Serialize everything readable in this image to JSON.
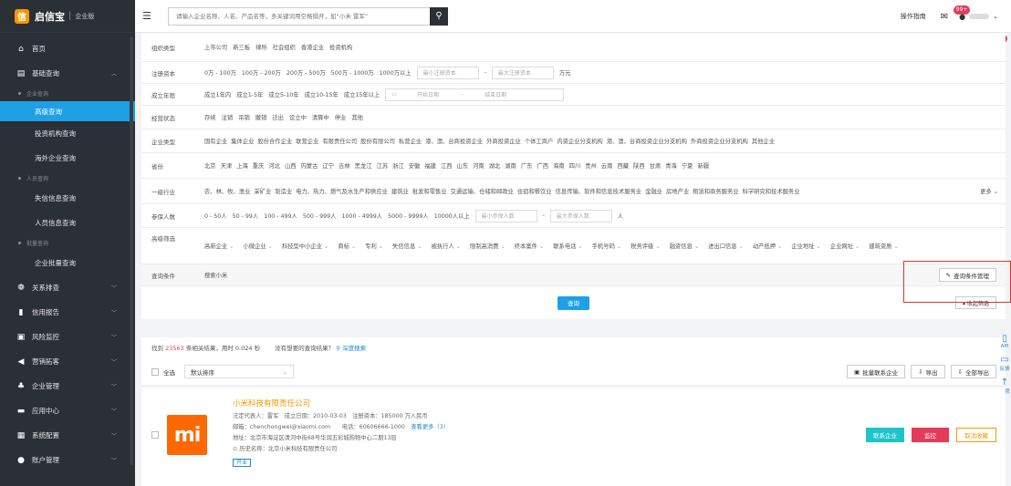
{
  "brand": {
    "name": "启信宝",
    "edition": "企业版"
  },
  "search": {
    "placeholder": "请输入企业名称、人名、产品名等，多关键词用空格隔开，如“小米 雷军”"
  },
  "topbar": {
    "guide": "操作指南",
    "badge": "99+"
  },
  "share_badge": "9",
  "sidebar": {
    "home": "首页",
    "basic_query": "基础查询",
    "group_enterprise": "企业查询",
    "advanced": "高级查询",
    "investor": "投资机构查询",
    "overseas": "海外企业查询",
    "group_person": "人员查询",
    "dishonest": "失信信息查询",
    "person_info": "人员信息查询",
    "group_batch": "批量查询",
    "batch": "企业批量查询",
    "relation": "关系排查",
    "credit": "信用报告",
    "risk": "风险监控",
    "marketing": "营销拓客",
    "management": "企业管理",
    "app_center": "应用中心",
    "system": "系统配置",
    "account": "账户管理"
  },
  "filters": {
    "org_type": {
      "label": "组织类型",
      "options": [
        "上市公司",
        "新三板",
        "律所",
        "社会组织",
        "香港企业",
        "投资机构"
      ]
    },
    "capital": {
      "label": "注册资本",
      "options": [
        "0万 - 100万",
        "100万 - 200万",
        "200万 - 500万",
        "500万 - 1000万",
        "1000万以上"
      ],
      "min": "最小注册资本",
      "max": "最大注册资本",
      "unit": "万元"
    },
    "founded": {
      "label": "成立年限",
      "options": [
        "成立1年内",
        "成立1-5年",
        "成立5-10年",
        "成立10-15年",
        "成立15年以上"
      ],
      "start": "开始日期",
      "end": "结束日期"
    },
    "status": {
      "label": "经营状态",
      "options": [
        "存续",
        "注销",
        "吊销",
        "撤销",
        "迁出",
        "设立中",
        "清算中",
        "停业",
        "其他"
      ]
    },
    "ent_type": {
      "label": "企业类型",
      "options": [
        "国有企业",
        "集体企业",
        "股份合作企业",
        "联营企业",
        "有限责任公司",
        "股份有限公司",
        "私营企业",
        "港、澳、台商投资企业",
        "外商投资企业",
        "个体工商户",
        "内资企业分支机构",
        "港、澳、台商投资企业分支机构",
        "外商投资企业分支机构",
        "其他企业"
      ]
    },
    "province": {
      "label": "省份",
      "options": [
        "北京",
        "天津",
        "上海",
        "重庆",
        "河北",
        "山西",
        "内蒙古",
        "辽宁",
        "吉林",
        "黑龙江",
        "江苏",
        "浙江",
        "安徽",
        "福建",
        "江西",
        "山东",
        "河南",
        "湖北",
        "湖南",
        "广东",
        "广西",
        "海南",
        "四川",
        "贵州",
        "云南",
        "西藏",
        "陕西",
        "甘肃",
        "青海",
        "宁夏",
        "新疆"
      ]
    },
    "industry": {
      "label": "一级行业",
      "options": [
        "农、林、牧、渔业",
        "采矿业",
        "制造业",
        "电力、热力、燃气及水生产和供应业",
        "建筑业",
        "批发和零售业",
        "交通运输、仓储和邮政业",
        "住宿和餐饮业",
        "信息传输、软件和信息技术服务业",
        "金融业",
        "房地产业",
        "租赁和商务服务业",
        "科学研究和技术服务业"
      ],
      "more": "更多"
    },
    "insured": {
      "label": "参保人数",
      "options": [
        "0 - 50人",
        "50 - 99人",
        "100 - 499人",
        "500 - 999人",
        "1000 - 4999人",
        "5000 - 9999人",
        "10000人以上"
      ],
      "min": "最小参保人数",
      "max": "最大参保人数",
      "unit": "人"
    },
    "advanced": {
      "label": "高级筛选",
      "options": [
        "高新企业",
        "小微企业",
        "科技型中小企业",
        "商标",
        "专利",
        "失信信息",
        "被执行人",
        "限制高消费",
        "终本案件",
        "联系电话",
        "手机号码",
        "税务评级",
        "融资信息",
        "进出口信息",
        "动产抵押",
        "企业地址",
        "企业网址",
        "建筑资质"
      ]
    },
    "conditions": {
      "label": "查询条件",
      "value": "搜索小米",
      "manage": "查询条件管理"
    }
  },
  "query_button": "查询",
  "collapse": "收起筛选",
  "results": {
    "prefix": "找到",
    "count": "23563",
    "suffix": "条相关结果，用时 0.024 秒",
    "not_found": "没有想要的查询结果？",
    "deep": "深度搜索",
    "select_all": "全选",
    "sort": "默认排序",
    "batch_contact": "批量联系企业",
    "export": "导出",
    "export_all": "全部导出"
  },
  "right_tools": {
    "api": "API",
    "feedback": "反馈",
    "top": "置顶"
  },
  "company": {
    "name": "小米科技有限责任公司",
    "legal_label": "法定代表人：",
    "legal": "雷军",
    "founded_label": "成立日期：",
    "founded": "2010-03-03",
    "capital_label": "注册资本：",
    "capital": "185000 万人民币",
    "email_label": "邮箱：",
    "email": "chenchongwei@xiaomi.com",
    "phone_label": "电话：",
    "phone": "60606666-1000",
    "more": "查看更多（3）",
    "address_label": "地址：",
    "address": "北京市海淀区清河中街68号华润五彩城购物中心二期13层",
    "history_label": "历史名称：",
    "history": "北京小米科技有限责任公司",
    "tag": "开业",
    "contact": "联系企业",
    "monitor": "监控",
    "unfavorite": "取消收藏",
    "logo_text": "mi",
    "logo_color": "#ff6700"
  },
  "colors": {
    "accent": "#1ea0e6",
    "sidebar": "#2b2f36",
    "danger": "#e63a5a"
  }
}
